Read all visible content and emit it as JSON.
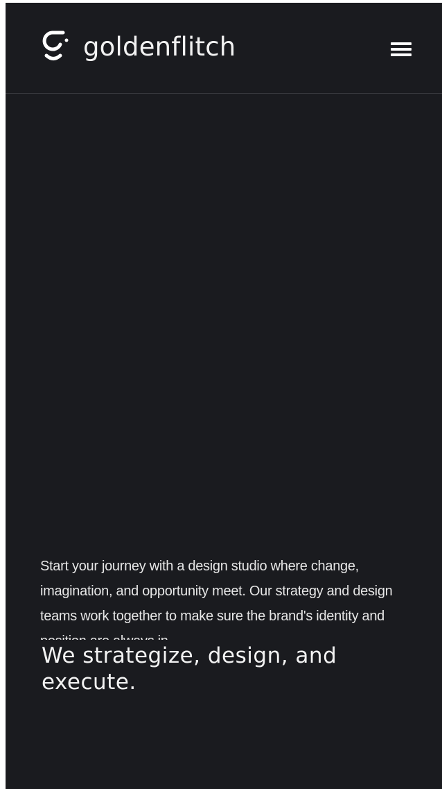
{
  "header": {
    "brand_name": "goldenflitch",
    "logo_icon": "goldenflitch-logo-mark",
    "menu_icon": "hamburger-menu-icon"
  },
  "hero": {
    "intro_text": "Start your journey with a design studio where change, imagination, and opportunity meet. Our strategy and design teams work together to make sure the brand's identity and position are always in",
    "headline": "We strategize, design, and execute."
  },
  "colors": {
    "background": "#1a1b1f",
    "text": "#f2f2f2",
    "divider": "#3a3b40"
  }
}
